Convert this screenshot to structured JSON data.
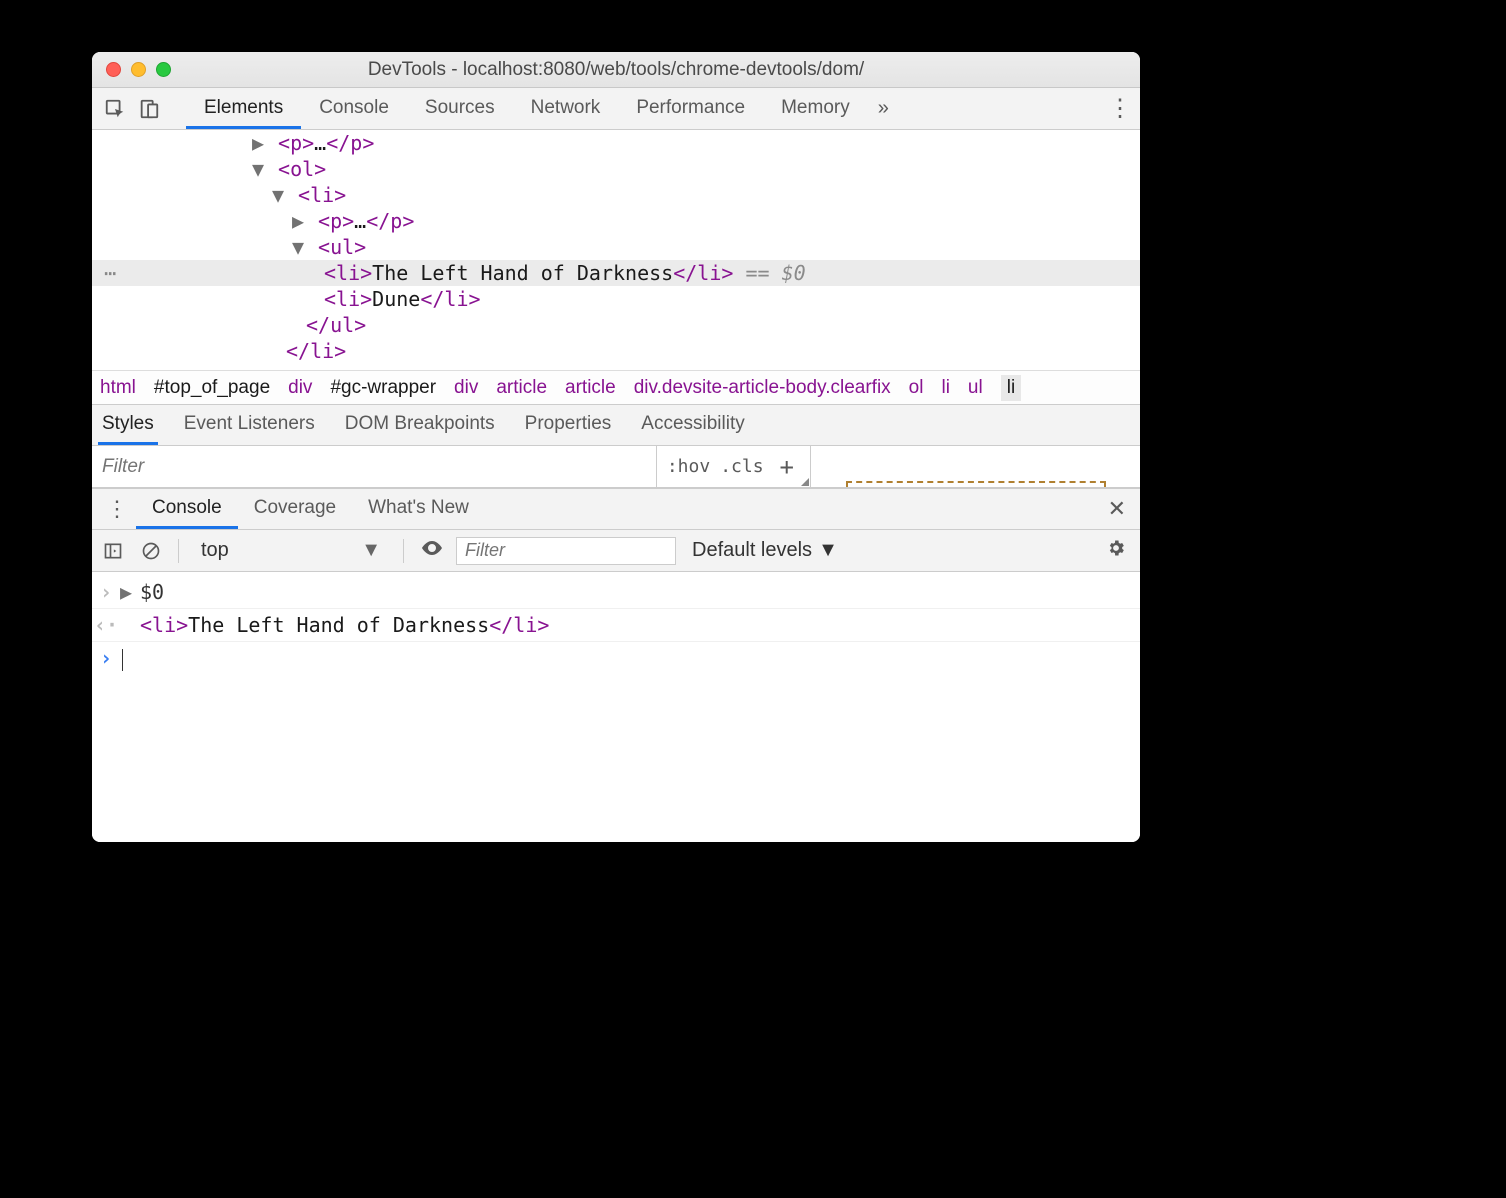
{
  "window": {
    "title": "DevTools - localhost:8080/web/tools/chrome-devtools/dom/"
  },
  "main_tabs": [
    "Elements",
    "Console",
    "Sources",
    "Network",
    "Performance",
    "Memory"
  ],
  "main_active": "Elements",
  "dom_tree": {
    "lines": [
      {
        "indent": 160,
        "tri": "▶",
        "open": "<p>",
        "mid": "…",
        "close": "</p>"
      },
      {
        "indent": 160,
        "tri": "▼",
        "open": "<ol>"
      },
      {
        "indent": 180,
        "tri": "▼",
        "open": "<li>"
      },
      {
        "indent": 200,
        "tri": "▶",
        "open": "<p>",
        "mid": "…",
        "close": "</p>"
      },
      {
        "indent": 200,
        "tri": "▼",
        "open": "<ul>"
      },
      {
        "indent": 232,
        "selected": true,
        "open": "<li>",
        "text": "The Left Hand of Darkness",
        "close": "</li>",
        "suffix": " == $0"
      },
      {
        "indent": 232,
        "open": "<li>",
        "text": "Dune",
        "close": "</li>"
      },
      {
        "indent": 214,
        "open": "</ul>"
      },
      {
        "indent": 194,
        "open": "</li>"
      }
    ]
  },
  "breadcrumb": [
    {
      "t": "html",
      "cls": "crumb"
    },
    {
      "t": "#top_of_page",
      "cls": "crumb id"
    },
    {
      "t": "div",
      "cls": "crumb"
    },
    {
      "t": "#gc-wrapper",
      "cls": "crumb id"
    },
    {
      "t": "div",
      "cls": "crumb"
    },
    {
      "t": "article",
      "cls": "crumb"
    },
    {
      "t": "article",
      "cls": "crumb"
    },
    {
      "t": "div.devsite-article-body.clearfix",
      "cls": "crumb longp"
    },
    {
      "t": "ol",
      "cls": "crumb"
    },
    {
      "t": "li",
      "cls": "crumb"
    },
    {
      "t": "ul",
      "cls": "crumb"
    },
    {
      "t": "li",
      "cls": "crumb selcr"
    }
  ],
  "sub_tabs": [
    "Styles",
    "Event Listeners",
    "DOM Breakpoints",
    "Properties",
    "Accessibility"
  ],
  "sub_active": "Styles",
  "styles_filter_placeholder": "Filter",
  "hov_label": ":hov",
  "cls_label": ".cls",
  "drawer_tabs": [
    "Console",
    "Coverage",
    "What's New"
  ],
  "drawer_active": "Console",
  "console_context": "top",
  "console_filter_placeholder": "Filter",
  "console_levels": "Default levels",
  "console_rows": [
    {
      "kind": "input",
      "expandable": true,
      "text": "$0"
    },
    {
      "kind": "output",
      "html_open": "<li>",
      "html_text": "The Left Hand of Darkness",
      "html_close": "</li>"
    },
    {
      "kind": "prompt"
    }
  ]
}
